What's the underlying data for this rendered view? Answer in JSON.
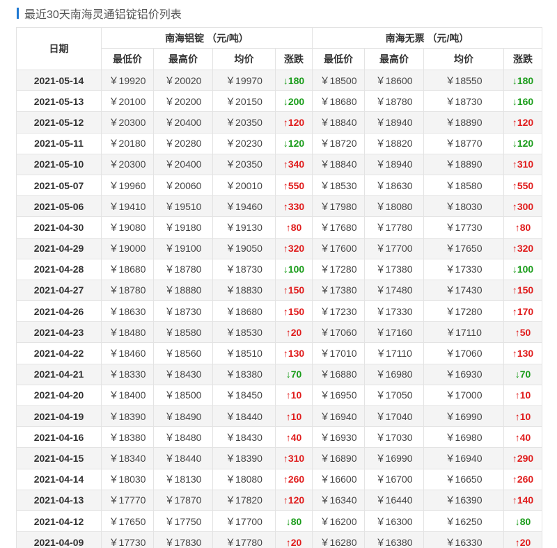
{
  "page": {
    "title": "最近30天南海灵通铝锭铝价列表"
  },
  "table": {
    "date_header": "日期",
    "group1": "南海铝锭 （元/吨）",
    "group2": "南海无票 （元/吨）",
    "sub_headers": [
      "最低价",
      "最高价",
      "均价",
      "涨跌",
      "最低价",
      "最高价",
      "均价",
      "涨跌"
    ],
    "colors": {
      "up": "#e01c1c",
      "down": "#1a9c1a",
      "accent": "#1e78d2"
    },
    "rows": [
      {
        "date": "2021-05-14",
        "a_low": "￥19920",
        "a_high": "￥20020",
        "a_avg": "￥19970",
        "a_chg": "↓180",
        "a_dir": "down",
        "b_low": "￥18500",
        "b_high": "￥18600",
        "b_avg": "￥18550",
        "b_chg": "↓180",
        "b_dir": "down"
      },
      {
        "date": "2021-05-13",
        "a_low": "￥20100",
        "a_high": "￥20200",
        "a_avg": "￥20150",
        "a_chg": "↓200",
        "a_dir": "down",
        "b_low": "￥18680",
        "b_high": "￥18780",
        "b_avg": "￥18730",
        "b_chg": "↓160",
        "b_dir": "down"
      },
      {
        "date": "2021-05-12",
        "a_low": "￥20300",
        "a_high": "￥20400",
        "a_avg": "￥20350",
        "a_chg": "↑120",
        "a_dir": "up",
        "b_low": "￥18840",
        "b_high": "￥18940",
        "b_avg": "￥18890",
        "b_chg": "↑120",
        "b_dir": "up"
      },
      {
        "date": "2021-05-11",
        "a_low": "￥20180",
        "a_high": "￥20280",
        "a_avg": "￥20230",
        "a_chg": "↓120",
        "a_dir": "down",
        "b_low": "￥18720",
        "b_high": "￥18820",
        "b_avg": "￥18770",
        "b_chg": "↓120",
        "b_dir": "down"
      },
      {
        "date": "2021-05-10",
        "a_low": "￥20300",
        "a_high": "￥20400",
        "a_avg": "￥20350",
        "a_chg": "↑340",
        "a_dir": "up",
        "b_low": "￥18840",
        "b_high": "￥18940",
        "b_avg": "￥18890",
        "b_chg": "↑310",
        "b_dir": "up"
      },
      {
        "date": "2021-05-07",
        "a_low": "￥19960",
        "a_high": "￥20060",
        "a_avg": "￥20010",
        "a_chg": "↑550",
        "a_dir": "up",
        "b_low": "￥18530",
        "b_high": "￥18630",
        "b_avg": "￥18580",
        "b_chg": "↑550",
        "b_dir": "up"
      },
      {
        "date": "2021-05-06",
        "a_low": "￥19410",
        "a_high": "￥19510",
        "a_avg": "￥19460",
        "a_chg": "↑330",
        "a_dir": "up",
        "b_low": "￥17980",
        "b_high": "￥18080",
        "b_avg": "￥18030",
        "b_chg": "↑300",
        "b_dir": "up"
      },
      {
        "date": "2021-04-30",
        "a_low": "￥19080",
        "a_high": "￥19180",
        "a_avg": "￥19130",
        "a_chg": "↑80",
        "a_dir": "up",
        "b_low": "￥17680",
        "b_high": "￥17780",
        "b_avg": "￥17730",
        "b_chg": "↑80",
        "b_dir": "up"
      },
      {
        "date": "2021-04-29",
        "a_low": "￥19000",
        "a_high": "￥19100",
        "a_avg": "￥19050",
        "a_chg": "↑320",
        "a_dir": "up",
        "b_low": "￥17600",
        "b_high": "￥17700",
        "b_avg": "￥17650",
        "b_chg": "↑320",
        "b_dir": "up"
      },
      {
        "date": "2021-04-28",
        "a_low": "￥18680",
        "a_high": "￥18780",
        "a_avg": "￥18730",
        "a_chg": "↓100",
        "a_dir": "down",
        "b_low": "￥17280",
        "b_high": "￥17380",
        "b_avg": "￥17330",
        "b_chg": "↓100",
        "b_dir": "down"
      },
      {
        "date": "2021-04-27",
        "a_low": "￥18780",
        "a_high": "￥18880",
        "a_avg": "￥18830",
        "a_chg": "↑150",
        "a_dir": "up",
        "b_low": "￥17380",
        "b_high": "￥17480",
        "b_avg": "￥17430",
        "b_chg": "↑150",
        "b_dir": "up"
      },
      {
        "date": "2021-04-26",
        "a_low": "￥18630",
        "a_high": "￥18730",
        "a_avg": "￥18680",
        "a_chg": "↑150",
        "a_dir": "up",
        "b_low": "￥17230",
        "b_high": "￥17330",
        "b_avg": "￥17280",
        "b_chg": "↑170",
        "b_dir": "up"
      },
      {
        "date": "2021-04-23",
        "a_low": "￥18480",
        "a_high": "￥18580",
        "a_avg": "￥18530",
        "a_chg": "↑20",
        "a_dir": "up",
        "b_low": "￥17060",
        "b_high": "￥17160",
        "b_avg": "￥17110",
        "b_chg": "↑50",
        "b_dir": "up"
      },
      {
        "date": "2021-04-22",
        "a_low": "￥18460",
        "a_high": "￥18560",
        "a_avg": "￥18510",
        "a_chg": "↑130",
        "a_dir": "up",
        "b_low": "￥17010",
        "b_high": "￥17110",
        "b_avg": "￥17060",
        "b_chg": "↑130",
        "b_dir": "up"
      },
      {
        "date": "2021-04-21",
        "a_low": "￥18330",
        "a_high": "￥18430",
        "a_avg": "￥18380",
        "a_chg": "↓70",
        "a_dir": "down",
        "b_low": "￥16880",
        "b_high": "￥16980",
        "b_avg": "￥16930",
        "b_chg": "↓70",
        "b_dir": "down"
      },
      {
        "date": "2021-04-20",
        "a_low": "￥18400",
        "a_high": "￥18500",
        "a_avg": "￥18450",
        "a_chg": "↑10",
        "a_dir": "up",
        "b_low": "￥16950",
        "b_high": "￥17050",
        "b_avg": "￥17000",
        "b_chg": "↑10",
        "b_dir": "up"
      },
      {
        "date": "2021-04-19",
        "a_low": "￥18390",
        "a_high": "￥18490",
        "a_avg": "￥18440",
        "a_chg": "↑10",
        "a_dir": "up",
        "b_low": "￥16940",
        "b_high": "￥17040",
        "b_avg": "￥16990",
        "b_chg": "↑10",
        "b_dir": "up"
      },
      {
        "date": "2021-04-16",
        "a_low": "￥18380",
        "a_high": "￥18480",
        "a_avg": "￥18430",
        "a_chg": "↑40",
        "a_dir": "up",
        "b_low": "￥16930",
        "b_high": "￥17030",
        "b_avg": "￥16980",
        "b_chg": "↑40",
        "b_dir": "up"
      },
      {
        "date": "2021-04-15",
        "a_low": "￥18340",
        "a_high": "￥18440",
        "a_avg": "￥18390",
        "a_chg": "↑310",
        "a_dir": "up",
        "b_low": "￥16890",
        "b_high": "￥16990",
        "b_avg": "￥16940",
        "b_chg": "↑290",
        "b_dir": "up"
      },
      {
        "date": "2021-04-14",
        "a_low": "￥18030",
        "a_high": "￥18130",
        "a_avg": "￥18080",
        "a_chg": "↑260",
        "a_dir": "up",
        "b_low": "￥16600",
        "b_high": "￥16700",
        "b_avg": "￥16650",
        "b_chg": "↑260",
        "b_dir": "up"
      },
      {
        "date": "2021-04-13",
        "a_low": "￥17770",
        "a_high": "￥17870",
        "a_avg": "￥17820",
        "a_chg": "↑120",
        "a_dir": "up",
        "b_low": "￥16340",
        "b_high": "￥16440",
        "b_avg": "￥16390",
        "b_chg": "↑140",
        "b_dir": "up"
      },
      {
        "date": "2021-04-12",
        "a_low": "￥17650",
        "a_high": "￥17750",
        "a_avg": "￥17700",
        "a_chg": "↓80",
        "a_dir": "down",
        "b_low": "￥16200",
        "b_high": "￥16300",
        "b_avg": "￥16250",
        "b_chg": "↓80",
        "b_dir": "down"
      },
      {
        "date": "2021-04-09",
        "a_low": "￥17730",
        "a_high": "￥17830",
        "a_avg": "￥17780",
        "a_chg": "↑20",
        "a_dir": "up",
        "b_low": "￥16280",
        "b_high": "￥16380",
        "b_avg": "￥16330",
        "b_chg": "↑20",
        "b_dir": "up"
      }
    ]
  }
}
